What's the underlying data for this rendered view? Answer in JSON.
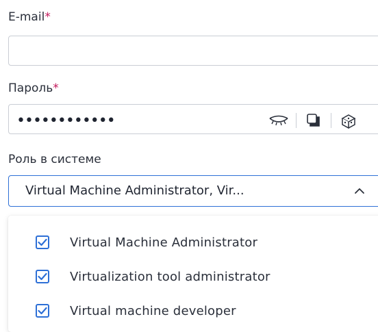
{
  "email": {
    "label": "E-mail",
    "required_mark": "*",
    "value": ""
  },
  "password": {
    "label": "Пароль",
    "required_mark": "*",
    "masked_value": "••••••••••••",
    "icons": [
      "eye-closed-icon",
      "copy-icon",
      "dice-icon"
    ]
  },
  "role": {
    "label": "Роль в системе",
    "selected_display": "Virtual Machine Administrator, Vir...",
    "expanded": true,
    "options": [
      {
        "label": "Virtual Machine Administrator",
        "checked": true
      },
      {
        "label": "Virtualization tool administrator",
        "checked": true
      },
      {
        "label": "Virtual machine developer",
        "checked": true
      }
    ]
  },
  "colors": {
    "accent": "#2d6fd6",
    "required": "#c2185b",
    "border": "#c9cdd4"
  }
}
